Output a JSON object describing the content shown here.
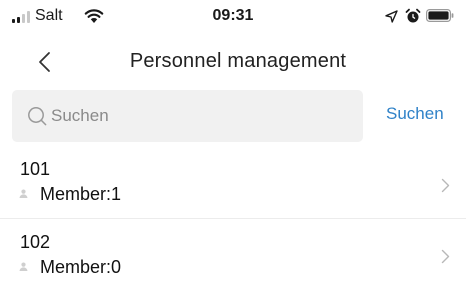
{
  "status_bar": {
    "carrier": "Salt",
    "time": "09:31"
  },
  "nav": {
    "title": "Personnel management"
  },
  "search": {
    "placeholder": "Suchen",
    "button_label": "Suchen"
  },
  "rooms": [
    {
      "number": "101",
      "members": "Member:1"
    },
    {
      "number": "102",
      "members": "Member:0"
    }
  ],
  "colors": {
    "accent": "#2f82c8",
    "search_bg": "#f1f1f1"
  }
}
